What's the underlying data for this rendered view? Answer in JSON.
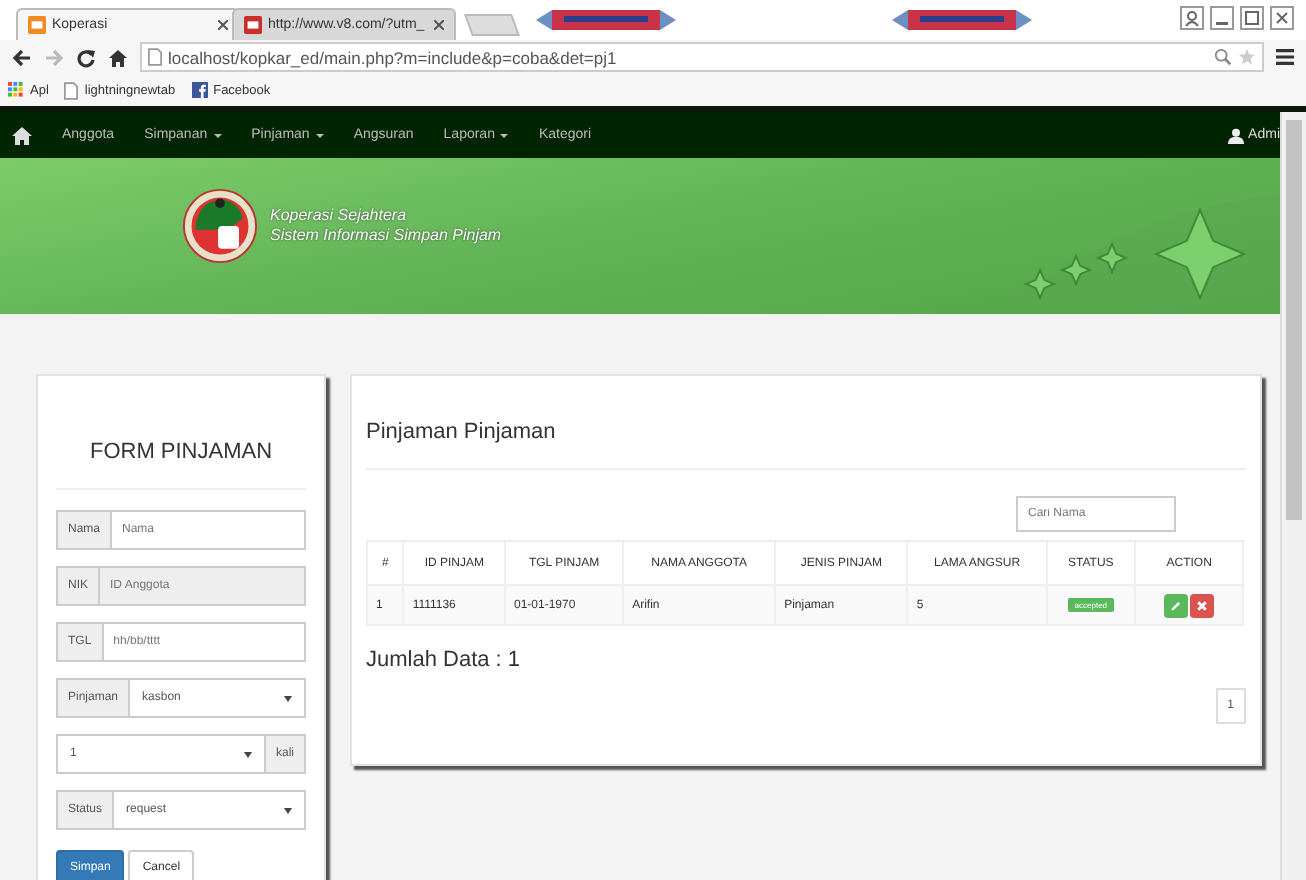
{
  "browser": {
    "tabs": [
      {
        "title": "Koperasi",
        "selected": true
      },
      {
        "title": "http://www.v8.com/?utm_",
        "selected": false
      }
    ],
    "url": "localhost/kopkar_ed/main.php?m=include&p=coba&det=pj1",
    "bookmarks": [
      {
        "kind": "apps",
        "label": "Apl"
      },
      {
        "kind": "page",
        "label": "lightningnewtab"
      },
      {
        "kind": "facebook",
        "label": "Facebook"
      }
    ]
  },
  "navbar": {
    "items": [
      {
        "label": "Anggota",
        "dropdown": false
      },
      {
        "label": "Simpanan",
        "dropdown": true
      },
      {
        "label": "Pinjaman",
        "dropdown": true
      },
      {
        "label": "Angsuran",
        "dropdown": false
      },
      {
        "label": "Laporan",
        "dropdown": true
      },
      {
        "label": "Kategori",
        "dropdown": false
      }
    ],
    "user": "Admi"
  },
  "banner": {
    "title": "Koperasi Sejahtera",
    "subtitle": "Sistem Informasi Simpan Pinjam"
  },
  "form": {
    "title": "FORM PINJAMAN",
    "fields": [
      {
        "kind": "input",
        "addon": "Nama",
        "placeholder": "Nama",
        "disabled": false
      },
      {
        "kind": "input",
        "addon": "NIK",
        "placeholder": "ID Anggota",
        "disabled": true
      },
      {
        "kind": "input",
        "addon": "TGL",
        "placeholder": "hh/bb/tttt",
        "disabled": false
      },
      {
        "kind": "select",
        "addon": "Pinjaman",
        "value": "kasbon"
      },
      {
        "kind": "select-suffix",
        "value": "1",
        "suffix": "kali"
      },
      {
        "kind": "select",
        "addon": "Status",
        "value": "request"
      }
    ],
    "buttons": [
      {
        "label": "Simpan",
        "kind": "primary"
      },
      {
        "label": "Cancel",
        "kind": "default"
      }
    ]
  },
  "table_panel": {
    "title": "Pinjaman Pinjaman",
    "search": {
      "placeholder": "Cari Nama"
    },
    "columns": [
      "#",
      "ID PINJAM",
      "TGL PINJAM",
      "NAMA ANGGOTA",
      "JENIS PINJAM",
      "LAMA ANGSUR",
      "STATUS",
      "ACTION"
    ],
    "rows": [
      {
        "cells": [
          "1",
          "1111136",
          "01-01-1970",
          "Arifin",
          "Pinjaman",
          "5"
        ],
        "status": "accepted",
        "color": "#5cb85c"
      }
    ],
    "total": "Jumlah Data : 1",
    "pages": [
      {
        "label": "1",
        "selected": false
      }
    ]
  }
}
